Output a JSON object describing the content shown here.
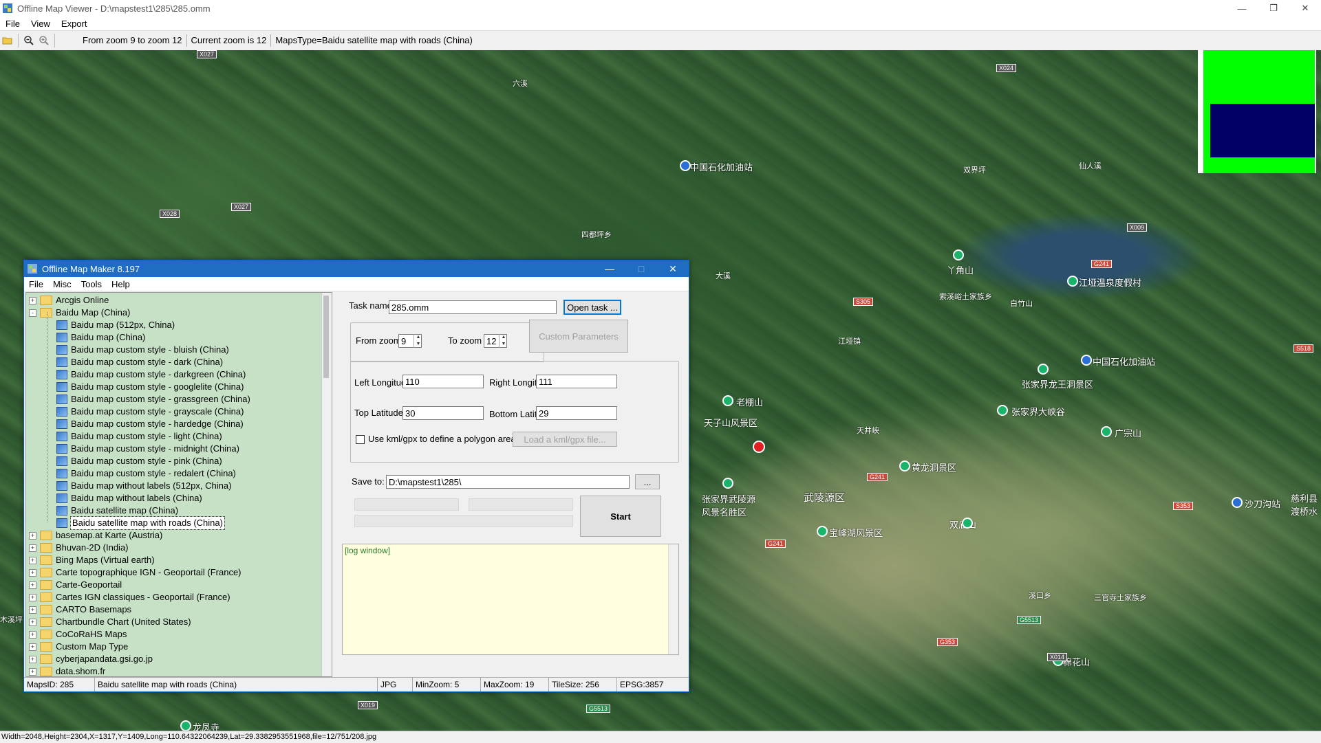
{
  "window": {
    "title": "Offline Map Viewer - D:\\mapstest1\\285\\285.omm",
    "menu": [
      "File",
      "View",
      "Export"
    ]
  },
  "toolbar": {
    "zoom_range": "From zoom 9 to zoom 12",
    "current_zoom": "Current zoom is 12",
    "maps_type": "MapsType=Baidu satellite map with roads (China)"
  },
  "map_labels": [
    "中国石化加油站",
    "双界坪",
    "仙人溪",
    "中国石化加油站",
    "江垭温泉度假村",
    "张家界龙王洞景区",
    "张家界大峡谷",
    "广宗山",
    "黄龙洞景区",
    "武陵源区",
    "宝峰湖风景区",
    "张家界武陵源风景名胜区",
    "天子山风景区",
    "老棚山",
    "丫角山",
    "双庙山",
    "棉花山",
    "白竹山",
    "沙刀沟站",
    "慈利县渡桥水",
    "江垭镇",
    "天井峡",
    "大溪",
    "溪口乡",
    "索溪峪土家族乡",
    "四都坪乡",
    "龙凤寺",
    "木溪坪",
    "六溪",
    "三官寺土家族乡"
  ],
  "road_shields": [
    "X027",
    "X024",
    "X028",
    "X027",
    "X009",
    "G241",
    "S305",
    "S518",
    "G241",
    "G241",
    "S353",
    "G353",
    "G5513",
    "X014",
    "X019",
    "G5513"
  ],
  "statusbar": {
    "text": "Width=2048,Height=2304,X=1317,Y=1409,Long=110.64322064239,Lat=29.3382953551968,file=12/751/208.jpg"
  },
  "dialog": {
    "title": "Offline Map Maker 8.197",
    "menu": [
      "File",
      "Misc",
      "Tools",
      "Help"
    ],
    "tree": [
      {
        "label": "Arcgis Online",
        "level": 0,
        "type": "folder",
        "expander": "+"
      },
      {
        "label": "Baidu Map (China)",
        "level": 0,
        "type": "folder-open",
        "expander": "-"
      },
      {
        "label": "Baidu map (512px, China)",
        "level": 1,
        "type": "map"
      },
      {
        "label": "Baidu map (China)",
        "level": 1,
        "type": "map"
      },
      {
        "label": "Baidu map custom style - bluish (China)",
        "level": 1,
        "type": "map"
      },
      {
        "label": "Baidu map custom style - dark (China)",
        "level": 1,
        "type": "map"
      },
      {
        "label": "Baidu map custom style - darkgreen (China)",
        "level": 1,
        "type": "map"
      },
      {
        "label": "Baidu map custom style - googlelite (China)",
        "level": 1,
        "type": "map"
      },
      {
        "label": "Baidu map custom style - grassgreen (China)",
        "level": 1,
        "type": "map"
      },
      {
        "label": "Baidu map custom style - grayscale (China)",
        "level": 1,
        "type": "map"
      },
      {
        "label": "Baidu map custom style - hardedge (China)",
        "level": 1,
        "type": "map"
      },
      {
        "label": "Baidu map custom style - light (China)",
        "level": 1,
        "type": "map"
      },
      {
        "label": "Baidu map custom style - midnight (China)",
        "level": 1,
        "type": "map"
      },
      {
        "label": "Baidu map custom style - pink (China)",
        "level": 1,
        "type": "map"
      },
      {
        "label": "Baidu map custom style - redalert (China)",
        "level": 1,
        "type": "map"
      },
      {
        "label": "Baidu map without labels (512px, China)",
        "level": 1,
        "type": "map"
      },
      {
        "label": "Baidu map without labels (China)",
        "level": 1,
        "type": "map"
      },
      {
        "label": "Baidu satellite map (China)",
        "level": 1,
        "type": "map"
      },
      {
        "label": "Baidu satellite map with roads (China)",
        "level": 1,
        "type": "map",
        "selected": true
      },
      {
        "label": "basemap.at Karte (Austria)",
        "level": 0,
        "type": "folder",
        "expander": "+"
      },
      {
        "label": "Bhuvan-2D (India)",
        "level": 0,
        "type": "folder",
        "expander": "+"
      },
      {
        "label": "Bing Maps (Virtual earth)",
        "level": 0,
        "type": "folder",
        "expander": "+"
      },
      {
        "label": "Carte topographique IGN - Geoportail (France)",
        "level": 0,
        "type": "folder",
        "expander": "+"
      },
      {
        "label": "Carte-Geoportail",
        "level": 0,
        "type": "folder",
        "expander": "+"
      },
      {
        "label": "Cartes IGN classiques - Geoportail (France)",
        "level": 0,
        "type": "folder",
        "expander": "+"
      },
      {
        "label": "CARTO Basemaps",
        "level": 0,
        "type": "folder",
        "expander": "+"
      },
      {
        "label": "Chartbundle Chart (United States)",
        "level": 0,
        "type": "folder",
        "expander": "+"
      },
      {
        "label": "CoCoRaHS Maps",
        "level": 0,
        "type": "folder",
        "expander": "+"
      },
      {
        "label": "Custom Map Type",
        "level": 0,
        "type": "folder",
        "expander": "+"
      },
      {
        "label": "cyberjapandata.gsi.go.jp",
        "level": 0,
        "type": "folder",
        "expander": "+"
      },
      {
        "label": "data.shom.fr",
        "level": 0,
        "type": "folder",
        "expander": "+"
      }
    ],
    "task_name_label": "Task name",
    "task_name_value": "285.omm",
    "open_task": "Open task ...",
    "from_zoom_label": "From zoom",
    "from_zoom_value": "9",
    "to_zoom_label": "To zoom",
    "to_zoom_value": "12",
    "custom_params": "Custom Parameters",
    "left_lon_label": "Left Longitude",
    "left_lon_value": "110",
    "right_lon_label": "Right Longitude",
    "right_lon_value": "111",
    "top_lat_label": "Top Latitude",
    "top_lat_value": "30",
    "bottom_lat_label": "Bottom Latitude",
    "bottom_lat_value": "29",
    "kml_checkbox_label": "Use kml/gpx to define a polygon area",
    "load_kml": "Load a kml/gpx file...",
    "save_to_label": "Save to:",
    "save_to_value": "D:\\mapstest1\\285\\",
    "browse": "...",
    "start": "Start",
    "log": "[log window]",
    "status": {
      "maps_id": "MapsID: 285",
      "maps_name": "Baidu satellite map with roads (China)",
      "format": "JPG",
      "min_zoom": "MinZoom: 5",
      "max_zoom": "MaxZoom: 19",
      "tile_size": "TileSize: 256",
      "epsg": "EPSG:3857"
    }
  },
  "colors": {
    "dialog_title": "#1f6dc2",
    "tree_bg": "#c7e1c7",
    "log_bg": "#ffffe0",
    "overview_green": "#00ff00",
    "overview_blue": "#000066"
  }
}
